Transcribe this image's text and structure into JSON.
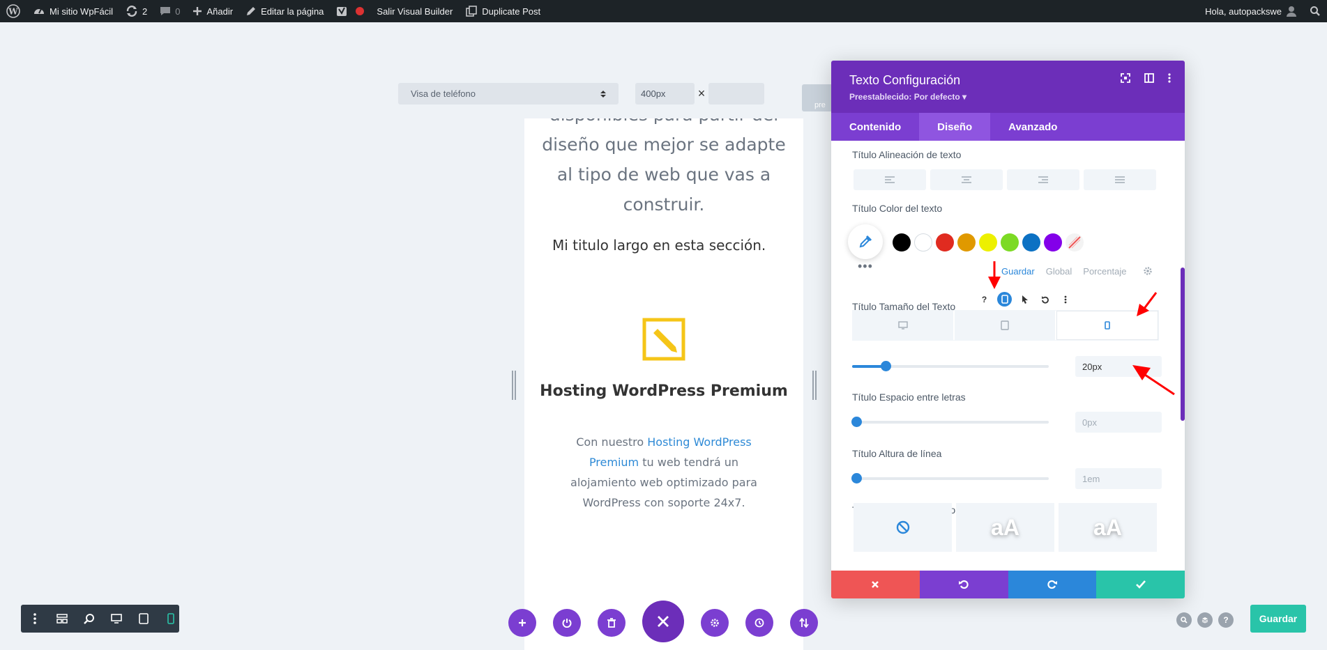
{
  "admin_bar": {
    "site_name": "Mi sitio WpFácil",
    "updates_count": "2",
    "comments_count": "0",
    "add_new": "Añadir",
    "edit_page": "Editar la página",
    "exit_builder": "Salir Visual Builder",
    "duplicate_post": "Duplicate Post",
    "greeting": "Hola, autopackswe"
  },
  "preview_bar": {
    "view_mode": "Visa de teléfono",
    "width_value": "400px",
    "preview_button_label": "pre"
  },
  "phone_preview": {
    "paragraph_lines": [
      "disponibles para partir del",
      "diseño que mejor se adapte",
      "al tipo de web que vas a",
      "construir."
    ],
    "heading": "Mi titulo largo en esta sección.",
    "blurb_title": "Hosting WordPress Premium",
    "blurb_text_before": "Con nuestro ",
    "blurb_link": "Hosting WordPress Premium",
    "blurb_text_after": " tu web tendrá un alojamiento web optimizado para WordPress con soporte 24x7."
  },
  "modal": {
    "title": "Texto Configuración",
    "preset": "Preestablecido: Por defecto ▾",
    "tabs": [
      "Contenido",
      "Diseño",
      "Avanzado"
    ],
    "active_tab": "Diseño",
    "options": {
      "alignment_label": "Título Alineación de texto",
      "color_label": "Título Color del texto",
      "swatch_colors": [
        "#000000",
        "#ffffff",
        "#e02b20",
        "#e09900",
        "#edf000",
        "#7cda24",
        "#0c71c3",
        "#8300e9"
      ],
      "color_tabs": [
        "Guardar",
        "Global",
        "Porcentaje"
      ],
      "font_size_label": "Título Tamaño del Texto",
      "font_size_value": "20px",
      "font_size_fraction": 0.17,
      "letter_spacing_label": "Título Espacio entre letras",
      "letter_spacing_value": "0px",
      "line_height_label": "Título Altura de línea",
      "line_height_value": "1em",
      "text_shadow_label": "Título Tamaño del Texto",
      "shadow_sample": "aA"
    }
  },
  "bottom": {
    "save_label": "Guardar"
  },
  "colors": {
    "admin_bar": "#1d2327",
    "modal_header": "#6c2eb9",
    "tabs_bar": "#7b3ed1",
    "accent_blue": "#2b87da",
    "save_green": "#29c4a9",
    "cancel_red": "#ef5555"
  }
}
